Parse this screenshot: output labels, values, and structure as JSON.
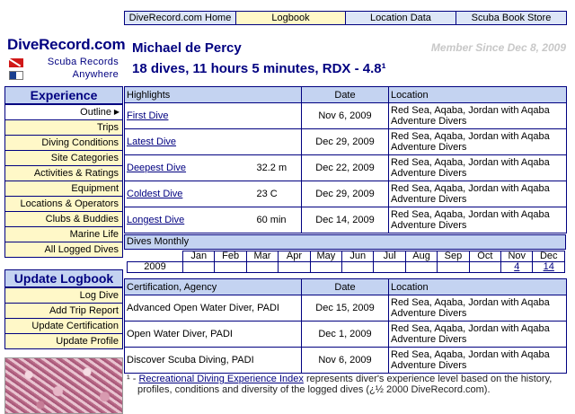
{
  "topnav": {
    "tabs": [
      {
        "label": "DiveRecord.com Home",
        "active": false
      },
      {
        "label": "Logbook",
        "active": true
      },
      {
        "label": "Location Data",
        "active": false
      },
      {
        "label": "Scuba Book Store",
        "active": false
      }
    ]
  },
  "logo": {
    "title": "DiveRecord.com",
    "tagline_1": "Scuba Records",
    "tagline_2": "Anywhere"
  },
  "sidebar": {
    "experience_heading": "Experience",
    "experience_items": [
      {
        "label": "Outline",
        "selected": true
      },
      {
        "label": "Trips"
      },
      {
        "label": "Diving Conditions"
      },
      {
        "label": "Site Categories"
      },
      {
        "label": "Activities & Ratings"
      },
      {
        "label": "Equipment"
      },
      {
        "label": "Locations & Operators"
      },
      {
        "label": "Clubs & Buddies"
      },
      {
        "label": "Marine Life"
      },
      {
        "label": "All Logged Dives"
      }
    ],
    "update_heading": "Update Logbook",
    "update_items": [
      {
        "label": "Log Dive"
      },
      {
        "label": "Add Trip Report"
      },
      {
        "label": "Update Certification"
      },
      {
        "label": "Update Profile"
      }
    ]
  },
  "header": {
    "diver_name": "Michael de Percy",
    "member_since": "Member Since Dec 8, 2009",
    "summary": "18 dives, 11 hours 5 minutes, RDX - 4.8¹"
  },
  "highlights": {
    "col_highlights": "Highlights",
    "col_date": "Date",
    "col_location": "Location",
    "rows": [
      {
        "name": "First Dive",
        "value": "",
        "date": "Nov 6, 2009",
        "location": "Red Sea, Aqaba, Jordan with Aqaba Adventure Divers"
      },
      {
        "name": "Latest Dive",
        "value": "",
        "date": "Dec 29, 2009",
        "location": "Red Sea, Aqaba, Jordan with Aqaba Adventure Divers"
      },
      {
        "name": "Deepest Dive",
        "value": "32.2 m",
        "date": "Dec 22, 2009",
        "location": "Red Sea, Aqaba, Jordan with Aqaba Adventure Divers"
      },
      {
        "name": "Coldest Dive",
        "value": "23 C",
        "date": "Dec 29, 2009",
        "location": "Red Sea, Aqaba, Jordan with Aqaba Adventure Divers"
      },
      {
        "name": "Longest Dive",
        "value": "60 min",
        "date": "Dec 14, 2009",
        "location": "Red Sea, Aqaba, Jordan with Aqaba Adventure Divers"
      }
    ]
  },
  "monthly": {
    "heading": "Dives Monthly",
    "months": [
      "Jan",
      "Feb",
      "Mar",
      "Apr",
      "May",
      "Jun",
      "Jul",
      "Aug",
      "Sep",
      "Oct",
      "Nov",
      "Dec"
    ],
    "year": "2009",
    "counts": [
      "",
      "",
      "",
      "",
      "",
      "",
      "",
      "",
      "",
      "",
      "4",
      "14"
    ]
  },
  "certifications": {
    "col_cert": "Certification, Agency",
    "col_date": "Date",
    "col_location": "Location",
    "rows": [
      {
        "name": "Advanced Open Water Diver, PADI",
        "date": "Dec 15, 2009",
        "location": "Red Sea, Aqaba, Jordan with Aqaba Adventure Divers"
      },
      {
        "name": "Open Water Diver, PADI",
        "date": "Dec 1, 2009",
        "location": "Red Sea, Aqaba, Jordan with Aqaba Adventure Divers"
      },
      {
        "name": "Discover Scuba Diving, PADI",
        "date": "Nov 6, 2009",
        "location": "Red Sea, Aqaba, Jordan with Aqaba Adventure Divers"
      }
    ]
  },
  "footnote": {
    "marker": "¹ -",
    "link": "Recreational Diving Experience Index",
    "text_1": "represents diver's experience level based on the history,",
    "text_2": "profiles, conditions and diversity of the logged dives (¿½ 2000 DiveRecord.com)."
  }
}
